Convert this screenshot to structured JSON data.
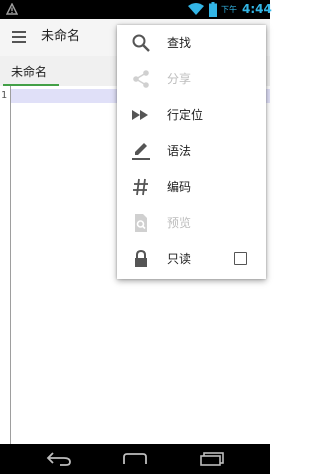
{
  "status_bar": {
    "ampm": "下午",
    "time": "4:44"
  },
  "app_bar": {
    "title": "未命名"
  },
  "tabs": [
    {
      "label": "未命名",
      "active": true
    }
  ],
  "editor": {
    "line_numbers": [
      "1"
    ]
  },
  "menu": {
    "items": [
      {
        "label": "查找",
        "icon": "search-icon",
        "enabled": true
      },
      {
        "label": "分享",
        "icon": "share-icon",
        "enabled": false
      },
      {
        "label": "行定位",
        "icon": "fast-forward-icon",
        "enabled": true
      },
      {
        "label": "语法",
        "icon": "pen-icon",
        "enabled": true
      },
      {
        "label": "编码",
        "icon": "hash-icon",
        "enabled": true
      },
      {
        "label": "预览",
        "icon": "preview-icon",
        "enabled": false
      },
      {
        "label": "只读",
        "icon": "lock-icon",
        "enabled": true,
        "checked": false
      }
    ]
  },
  "colors": {
    "accent_blue": "#33b5e5",
    "tab_underline": "#43a047",
    "current_line": "#e0e0f8"
  }
}
